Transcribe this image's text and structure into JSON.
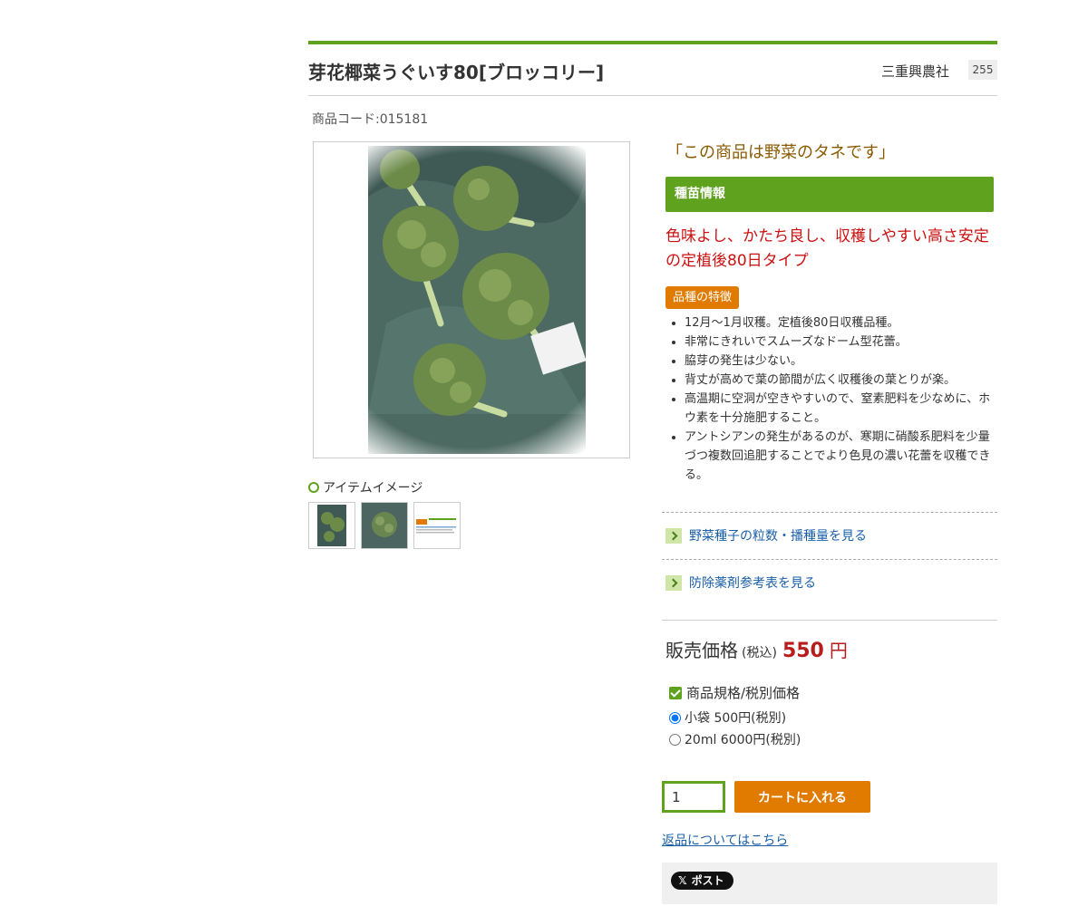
{
  "header": {
    "title": "芽花椰菜うぐいす80[ブロッコリー]",
    "maker": "三重興農社",
    "maker_code": "255"
  },
  "product": {
    "code": "商品コード:015181",
    "item_image_label": "アイテムイメージ",
    "tagline": "「この商品は野菜のタネです」",
    "info_heading": "種苗情報",
    "catchphrase": "色味よし、かたち良し、収穫しやすい高さ安定の定植後80日タイプ",
    "feature_badge": "品種の特徴",
    "features": [
      "12月〜1月収穫。定植後80日収穫品種。",
      "非常にきれいでスムーズなドーム型花蕾。",
      "脇芽の発生は少ない。",
      "背丈が高めで葉の節間が広く収穫後の葉とりが楽。",
      "高温期に空洞が空きやすいので、窒素肥料を少なめに、ホウ素を十分施肥すること。",
      "アントシアンの発生があるのが、寒期に硝酸系肥料を少量づつ複数回追肥することでより色見の濃い花蕾を収穫できる。"
    ]
  },
  "links": {
    "seed_count": "野菜種子の粒数・播種量を見る",
    "pesticide": "防除薬剤参考表を見る",
    "returns": "返品についてはこちら"
  },
  "price": {
    "label": "販売価格",
    "tax_note": "(税込)",
    "value": "550",
    "unit": "円"
  },
  "spec": {
    "heading": "商品規格/税別価格",
    "options": [
      {
        "label": "小袋 500円(税別)",
        "selected": true
      },
      {
        "label": "20ml 6000円(税別)",
        "selected": false
      }
    ]
  },
  "cart": {
    "quantity": "1",
    "button_label": "カートに入れる"
  },
  "social": {
    "x_post_label": "ポスト"
  },
  "colors": {
    "accent_green": "#5ea21e",
    "accent_orange": "#e07b00",
    "price_red": "#b81c1c",
    "link_blue": "#1a5fa8"
  }
}
